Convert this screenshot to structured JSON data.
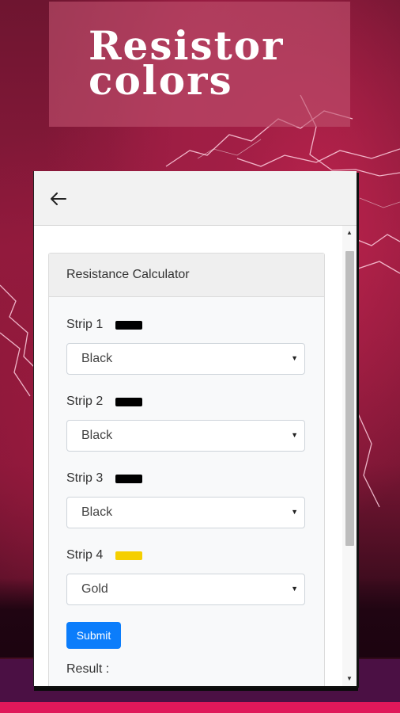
{
  "header": {
    "title_line1": "Resistor",
    "title_line2": "colors"
  },
  "appbar": {
    "back_icon": "arrow-left-icon"
  },
  "card": {
    "title": "Resistance Calculator"
  },
  "strips": [
    {
      "label": "Strip 1",
      "selected": "Black",
      "swatch": "#000000"
    },
    {
      "label": "Strip 2",
      "selected": "Black",
      "swatch": "#000000"
    },
    {
      "label": "Strip 3",
      "selected": "Black",
      "swatch": "#000000"
    },
    {
      "label": "Strip 4",
      "selected": "Gold",
      "swatch": "#f5cf00"
    }
  ],
  "submit_label": "Submit",
  "result_label": "Result :",
  "colors": {
    "accent": "#0b7dfb",
    "background": "#8a1836",
    "bottom_accent": "#e0185a"
  }
}
